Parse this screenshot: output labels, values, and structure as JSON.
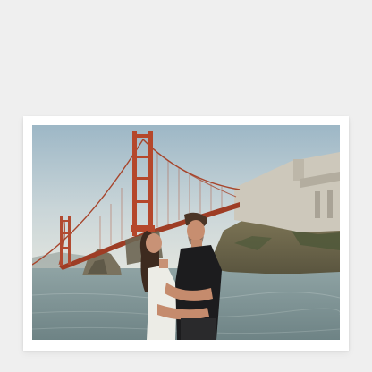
{
  "page": {
    "background_color": "#efefef",
    "card_color": "#ffffff"
  },
  "photo": {
    "subject": "couple-embracing-before-golden-gate-bridge",
    "palette": {
      "sky_top": "#9fb8c6",
      "sky_bottom": "#dfe6e4",
      "bridge_red": "#b5472b",
      "water": "#7f9396",
      "cliff": "#6f6a52",
      "fort": "#cfcbbf"
    }
  }
}
